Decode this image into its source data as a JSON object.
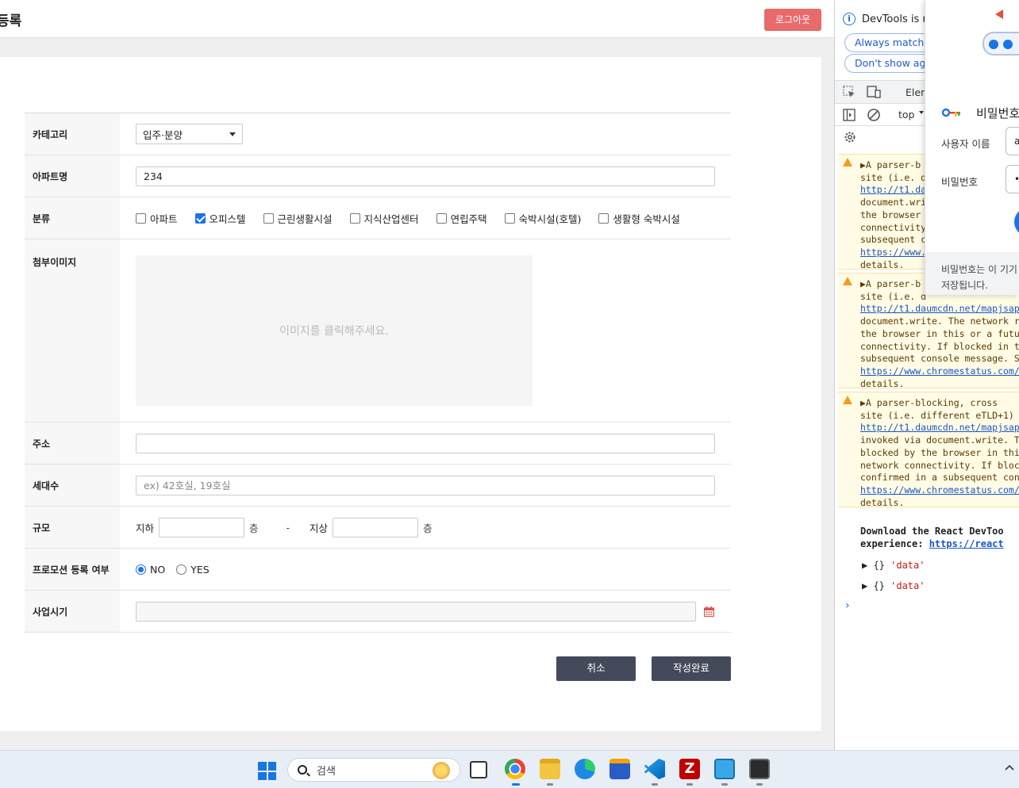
{
  "header": {
    "title": "등록",
    "logout_label": "로그아웃"
  },
  "form": {
    "category": {
      "label": "카테고리",
      "value": "입주·분양"
    },
    "apartment": {
      "label": "아파트명",
      "value": "234"
    },
    "type": {
      "label": "분류",
      "options": [
        {
          "label": "아파트",
          "checked": false
        },
        {
          "label": "오피스텔",
          "checked": true
        },
        {
          "label": "근린생활시설",
          "checked": false
        },
        {
          "label": "지식산업센터",
          "checked": false
        },
        {
          "label": "연립주택",
          "checked": false
        },
        {
          "label": "숙박시설(호텔)",
          "checked": false
        },
        {
          "label": "생활형 숙박시설",
          "checked": false
        }
      ]
    },
    "image": {
      "label": "첨부이미지",
      "placeholder": "이미지를 클릭해주세요."
    },
    "address": {
      "label": "주소",
      "value": ""
    },
    "households": {
      "label": "세대수",
      "placeholder": "ex) 42호실, 19호실"
    },
    "scale": {
      "label": "규모",
      "basement": "지하",
      "above": "지상",
      "unit": "층",
      "dash": "-"
    },
    "promotion": {
      "label": "프로모션 등록 여부",
      "options": [
        "NO",
        "YES"
      ],
      "selected": "NO"
    },
    "period": {
      "label": "사업시기"
    },
    "buttons": {
      "cancel": "취소",
      "submit": "작성완료"
    }
  },
  "devtools": {
    "info": "DevTools is n",
    "pill1": "Always match C",
    "pill2": "Don't show aga",
    "tab": "Elem",
    "context": "top",
    "warnings": [
      [
        "▶A parser-b",
        "site (i.e. d",
        "http://t1.da",
        "document.wri",
        "the browser",
        "connectivity",
        "subsequent c",
        "https://www.",
        "details."
      ],
      [
        "▶A parser-b",
        "site (i.e. d",
        "http://t1.daumcdn.net/mapjsap",
        "document.write. The network r",
        "the browser in this or a futu",
        "connectivity. If blocked in t",
        "subsequent console message. S",
        "https://www.chromestatus.com/",
        "details."
      ],
      [
        "▶A parser-blocking, cross",
        "site (i.e. different eTLD+1)",
        "http://t1.daumcdn.net/mapjsap",
        "invoked via document.write. T",
        "blocked by the browser in thi",
        "network connectivity. If bloc",
        "confirmed in a subsequent con",
        "https://www.chromestatus.com/",
        "details."
      ]
    ],
    "react_msg_1": "Download the React DevToo",
    "react_msg_2": "experience: ",
    "react_link": "https://react",
    "obj_prefix": "▶ {} ",
    "obj_label": "'data'",
    "prompt": "›"
  },
  "password_popup": {
    "title": "비밀번호",
    "username_label": "사용자 이름",
    "username_value": "ad",
    "password_label": "비밀번호",
    "password_value": "•",
    "footer_1": "비밀번호는 이 기기",
    "footer_2": "저장됩니다."
  },
  "taskbar": {
    "search_label": "검색"
  }
}
